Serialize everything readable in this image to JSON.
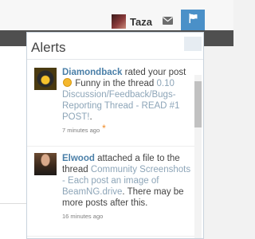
{
  "header": {
    "username": "Taza",
    "inbox_icon": "envelope-icon",
    "alerts_icon": "flag-icon",
    "accent": "#4a90c8"
  },
  "alerts_popup": {
    "title": "Alerts",
    "items": [
      {
        "user": "Diamondback",
        "action_before": " rated your post ",
        "rating_icon": "funny-smiley-icon",
        "action_after": " Funny in the thread ",
        "thread": "0.10 Discussion/Feedback/Bugs-Reporting Thread - READ #1 POST!",
        "trailing": ".",
        "time": "7 minutes ago",
        "unread_marker": "*"
      },
      {
        "user": "Elwood",
        "action_before": " attached a file to the thread ",
        "thread": "Community Screenshots - Each post an image of BeamNG.drive",
        "trailing": ". There may be more posts after this.",
        "time": "16 minutes ago"
      }
    ]
  },
  "colors": {
    "username_link": "#4a7fa8",
    "thread_link": "#8da5b8",
    "unread_star": "#f08a24"
  }
}
